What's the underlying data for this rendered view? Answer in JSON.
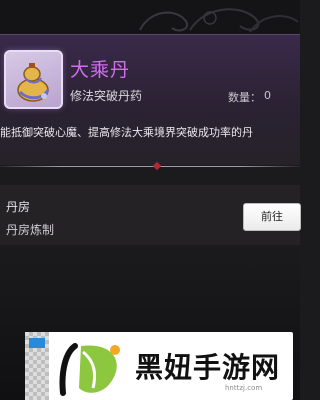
{
  "item": {
    "name": "大乘丹",
    "type": "修法突破丹药",
    "quantity_label": "数量：",
    "quantity_value": "0",
    "description": "能抵御突破心魔、提高修法大乘境界突破成功率的丹",
    "icon": "gourd-pill-icon"
  },
  "source": {
    "name": "丹房",
    "description": "丹房炼制",
    "go_label": "前往"
  },
  "watermark": {
    "brand": "黑妞手游网",
    "url": "hnttzj.com"
  },
  "colors": {
    "item_name": "#d36cf5",
    "panel_top": "#3a2a4a",
    "accent_gem": "#b02a35"
  }
}
